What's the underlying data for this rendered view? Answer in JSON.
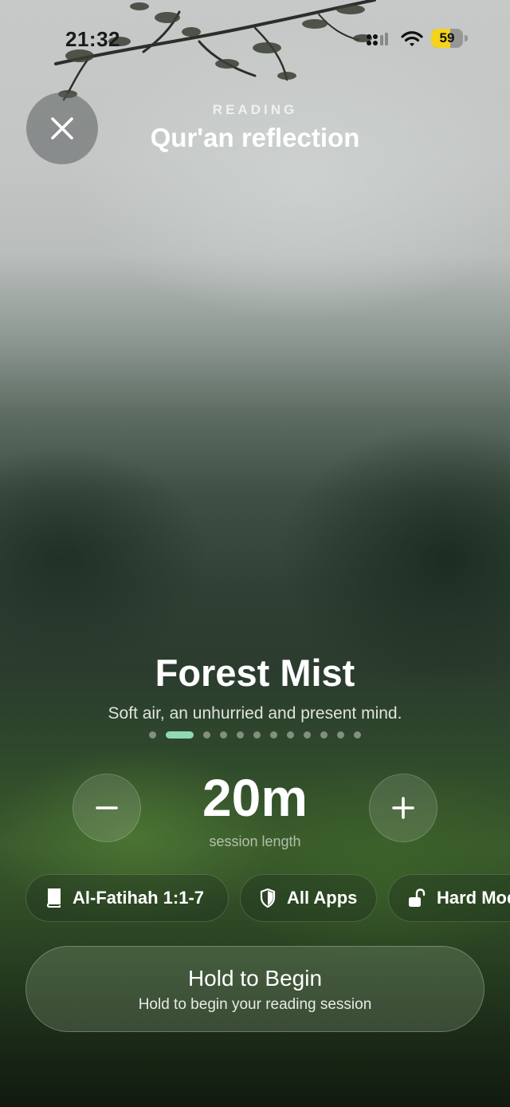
{
  "status_bar": {
    "time": "21:32",
    "battery_level": "59",
    "battery_fraction": 0.59,
    "battery_color": "#f5d21c",
    "icons": [
      "signal-icon",
      "wifi-icon",
      "battery-icon"
    ]
  },
  "header": {
    "close_icon": "close-icon",
    "kicker": "READING",
    "title": "Qur'an reflection"
  },
  "scene": {
    "name": "Forest Mist",
    "description": "Soft air, an unhurried and present mind.",
    "page_count": 12,
    "active_page": 1,
    "active_color": "#8fd9b4"
  },
  "timer": {
    "minus_icon": "minus-icon",
    "plus_icon": "plus-icon",
    "value": "20m",
    "label": "session length"
  },
  "chips": [
    {
      "icon": "book-icon",
      "label": "Al-Fatihah 1:1-7"
    },
    {
      "icon": "shield-icon",
      "label": "All Apps"
    },
    {
      "icon": "unlock-icon",
      "label": "Hard Mode"
    }
  ],
  "cta": {
    "title": "Hold to Begin",
    "subtitle": "Hold to begin your reading session"
  }
}
